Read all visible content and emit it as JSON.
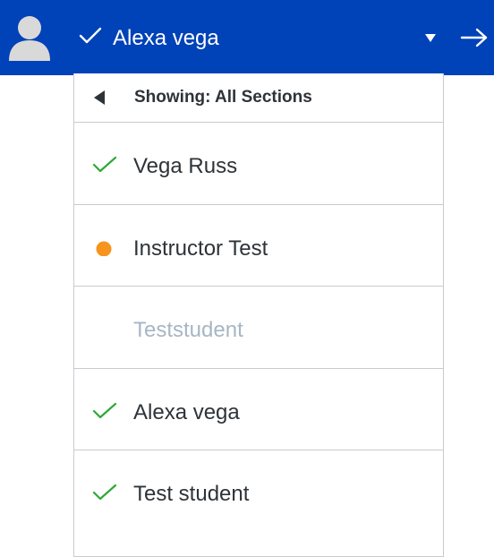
{
  "header": {
    "user_name": "Alexa vega",
    "avatar_icon": "user-avatar-icon",
    "check_icon": "checkmark-icon",
    "caret_icon": "caret-down-icon",
    "next_icon": "arrow-right-icon",
    "background_color": "#0042b8"
  },
  "dropdown": {
    "header_label": "Showing: All Sections",
    "back_icon": "triangle-left-icon",
    "items": [
      {
        "label": "Vega Russ",
        "status_icon": "checkmark-icon",
        "status_color": "#2ea836",
        "muted": false
      },
      {
        "label": "Instructor Test",
        "status_icon": "orange-dot-icon",
        "status_color": "#f7941d",
        "muted": false
      },
      {
        "label": "Teststudent",
        "status_icon": "",
        "status_color": "",
        "muted": true
      },
      {
        "label": "Alexa vega",
        "status_icon": "checkmark-icon",
        "status_color": "#2ea836",
        "muted": false
      },
      {
        "label": "Test student",
        "status_icon": "checkmark-icon",
        "status_color": "#2ea836",
        "muted": false
      }
    ]
  }
}
